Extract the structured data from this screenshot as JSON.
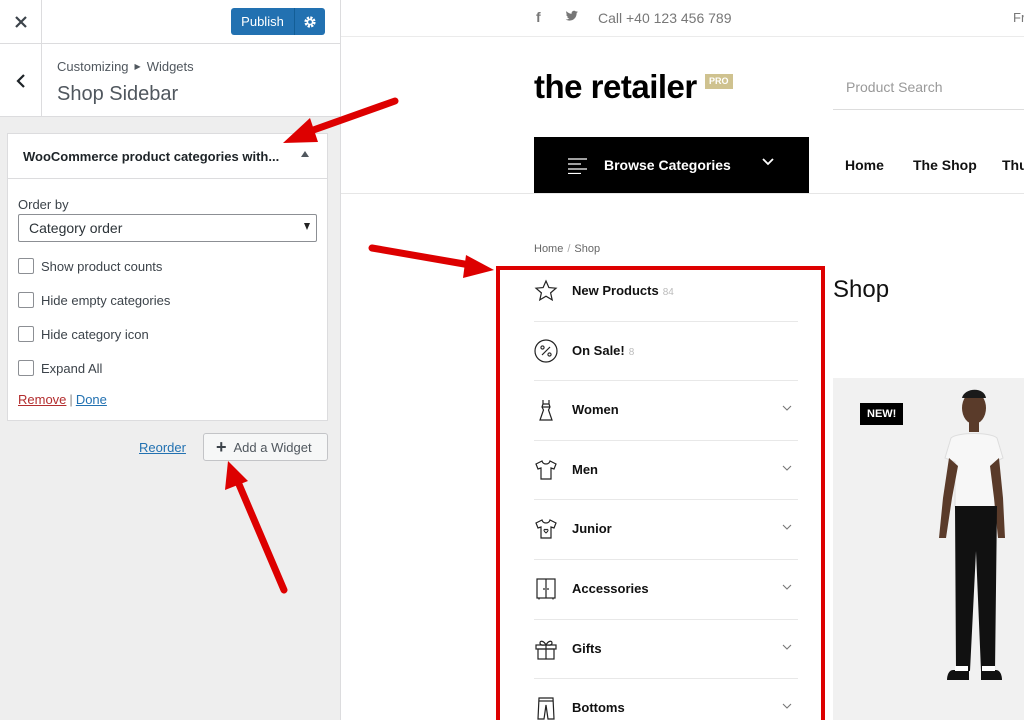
{
  "customizer": {
    "publish_label": "Publish",
    "breadcrumb": [
      "Customizing",
      "Widgets"
    ],
    "section_title": "Shop Sidebar",
    "widget": {
      "title": "WooCommerce product categories with...",
      "orderby_label": "Order by",
      "orderby_value": "Category order",
      "options": [
        {
          "label": "Show product counts",
          "checked": false
        },
        {
          "label": "Hide empty categories",
          "checked": false
        },
        {
          "label": "Hide category icon",
          "checked": false
        },
        {
          "label": "Expand All",
          "checked": false
        }
      ],
      "remove_label": "Remove",
      "actions_sep": "|",
      "done_label": "Done"
    },
    "reorder_label": "Reorder",
    "add_widget_label": "Add a Widget"
  },
  "preview": {
    "phone": "Call +40 123 456 789",
    "topbar_right": "Fr",
    "logo": "the retailer",
    "logo_badge": "PRO",
    "search_placeholder": "Product Search",
    "browse_label": "Browse Categories",
    "nav": [
      "Home",
      "The Shop",
      "Thu"
    ],
    "breadcrumb": [
      "Home",
      "Shop"
    ],
    "breadcrumb_sep": "/",
    "page_title": "Shop",
    "categories": [
      {
        "label": "New Products",
        "count": "84",
        "icon": "star-icon",
        "expandable": false
      },
      {
        "label": "On Sale!",
        "count": "8",
        "icon": "percent-icon",
        "expandable": false
      },
      {
        "label": "Women",
        "count": "",
        "icon": "dress-icon",
        "expandable": true
      },
      {
        "label": "Men",
        "count": "",
        "icon": "tshirt-icon",
        "expandable": true
      },
      {
        "label": "Junior",
        "count": "",
        "icon": "kids-shirt-icon",
        "expandable": true
      },
      {
        "label": "Accessories",
        "count": "",
        "icon": "wardrobe-icon",
        "expandable": true
      },
      {
        "label": "Gifts",
        "count": "",
        "icon": "gift-icon",
        "expandable": true
      },
      {
        "label": "Bottoms",
        "count": "",
        "icon": "pants-icon",
        "expandable": true
      }
    ],
    "product_badge": "NEW!"
  },
  "colors": {
    "wp_blue": "#2271b1",
    "annotation_red": "#dd0000",
    "logo_badge": "#cfc28f"
  }
}
